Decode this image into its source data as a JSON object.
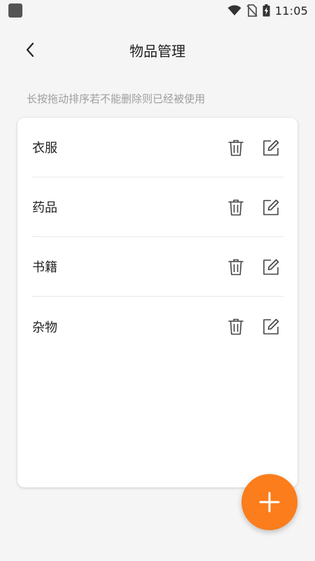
{
  "status_bar": {
    "time": "11:05"
  },
  "header": {
    "title": "物品管理"
  },
  "hint": "长按拖动排序若不能删除则已经被使用",
  "items": [
    {
      "label": "衣服"
    },
    {
      "label": "药品"
    },
    {
      "label": "书籍"
    },
    {
      "label": "杂物"
    }
  ],
  "icons": {
    "back": "chevron-left-icon",
    "delete": "trash-icon",
    "edit": "edit-icon",
    "add": "plus-icon"
  },
  "colors": {
    "accent": "#fb7d1c",
    "background": "#f5f5f5",
    "card": "#ffffff",
    "hint_text": "#9e9e9e"
  }
}
